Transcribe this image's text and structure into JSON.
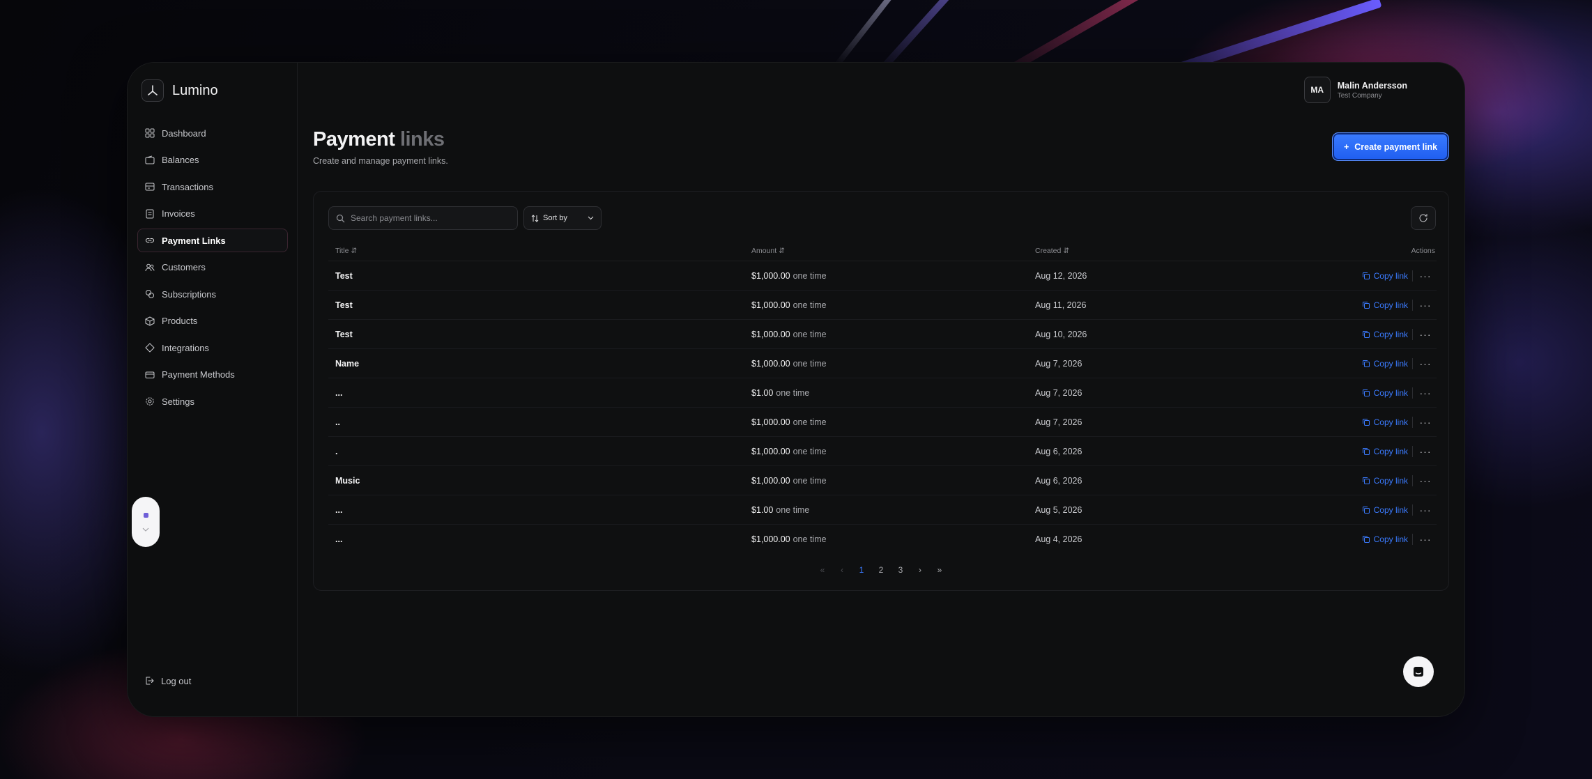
{
  "brand": {
    "name": "Lumino"
  },
  "nav": {
    "items": [
      {
        "label": "Dashboard",
        "icon": "grid-icon"
      },
      {
        "label": "Balances",
        "icon": "wallet-icon"
      },
      {
        "label": "Transactions",
        "icon": "transactions-icon"
      },
      {
        "label": "Invoices",
        "icon": "invoice-icon"
      },
      {
        "label": "Payment Links",
        "icon": "link-icon",
        "active": true
      },
      {
        "label": "Customers",
        "icon": "users-icon"
      },
      {
        "label": "Subscriptions",
        "icon": "subscriptions-icon"
      },
      {
        "label": "Products",
        "icon": "box-icon"
      },
      {
        "label": "Integrations",
        "icon": "integrations-icon"
      },
      {
        "label": "Payment Methods",
        "icon": "card-icon"
      },
      {
        "label": "Settings",
        "icon": "gear-icon"
      }
    ],
    "logout": "Log out"
  },
  "user": {
    "initials": "MA",
    "name": "Malin Andersson",
    "company": "Test Company"
  },
  "page": {
    "title_main": "Payment",
    "title_fade": " links",
    "subtitle": "Create and manage payment links.",
    "create_label": "Create payment link"
  },
  "toolbar": {
    "search_placeholder": "Search payment links...",
    "sort_label": "Sort by"
  },
  "table": {
    "headers": {
      "title": "Title",
      "amount": "Amount",
      "created": "Created",
      "actions": "Actions"
    },
    "copy_label": "Copy link",
    "rows": [
      {
        "title": "Test",
        "amount": "$1,000.00",
        "freq": "one time",
        "created": "Aug 12, 2026"
      },
      {
        "title": "Test",
        "amount": "$1,000.00",
        "freq": "one time",
        "created": "Aug 11, 2026"
      },
      {
        "title": "Test",
        "amount": "$1,000.00",
        "freq": "one time",
        "created": "Aug 10, 2026"
      },
      {
        "title": "Name",
        "amount": "$1,000.00",
        "freq": "one time",
        "created": "Aug 7, 2026"
      },
      {
        "title": "...",
        "amount": "$1.00",
        "freq": "one time",
        "created": "Aug 7, 2026"
      },
      {
        "title": "..",
        "amount": "$1,000.00",
        "freq": "one time",
        "created": "Aug 7, 2026"
      },
      {
        "title": ".",
        "amount": "$1,000.00",
        "freq": "one time",
        "created": "Aug 6, 2026"
      },
      {
        "title": "Music",
        "amount": "$1,000.00",
        "freq": "one time",
        "created": "Aug 6, 2026"
      },
      {
        "title": "...",
        "amount": "$1.00",
        "freq": "one time",
        "created": "Aug 5, 2026"
      },
      {
        "title": "...",
        "amount": "$1,000.00",
        "freq": "one time",
        "created": "Aug 4, 2026"
      }
    ]
  },
  "pagination": {
    "pages": [
      "1",
      "2",
      "3"
    ],
    "current": "1"
  },
  "colors": {
    "accent": "#3b7bff",
    "background": "#0e0f10"
  }
}
